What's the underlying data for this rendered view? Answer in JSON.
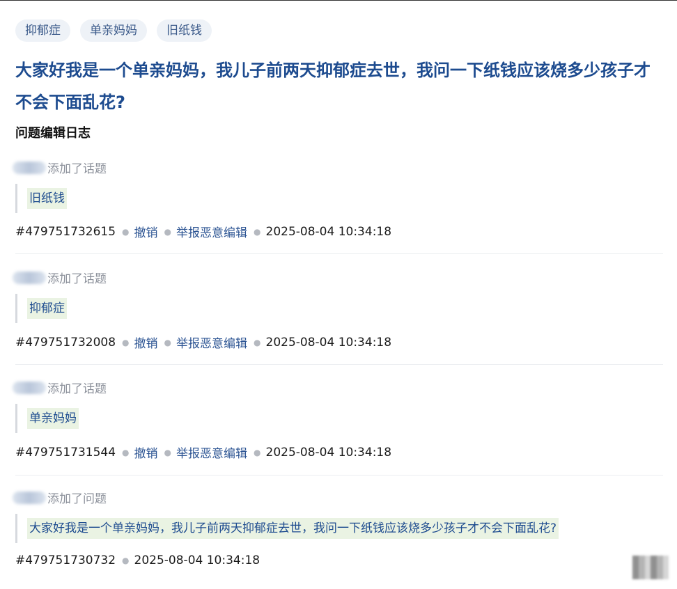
{
  "tags": [
    "抑郁症",
    "单亲妈妈",
    "旧纸钱"
  ],
  "question_title": "大家好我是一个单亲妈妈，我儿子前两天抑郁症去世，我问一下纸钱应该烧多少孩子才不会下面乱花?",
  "log_title": "问题编辑日志",
  "entries": [
    {
      "action": "添加了话题",
      "content": "旧纸钱",
      "id": "#479751732615",
      "undo": "撤销",
      "report": "举报恶意编辑",
      "time": "2025-08-04 10:34:18"
    },
    {
      "action": "添加了话题",
      "content": "抑郁症",
      "id": "#479751732008",
      "undo": "撤销",
      "report": "举报恶意编辑",
      "time": "2025-08-04 10:34:18"
    },
    {
      "action": "添加了话题",
      "content": "单亲妈妈",
      "id": "#479751731544",
      "undo": "撤销",
      "report": "举报恶意编辑",
      "time": "2025-08-04 10:34:18"
    },
    {
      "action": "添加了问题",
      "content": "大家好我是一个单亲妈妈，我儿子前两天抑郁症去世，我问一下纸钱应该烧多少孩子才不会下面乱花?",
      "id": "#479751730732",
      "time": "2025-08-04 10:34:18"
    }
  ],
  "colors": {
    "link": "#2c5493",
    "title": "#1d4b8f",
    "tag_bg": "#eef2f7",
    "highlight": "#eaf3e3"
  }
}
